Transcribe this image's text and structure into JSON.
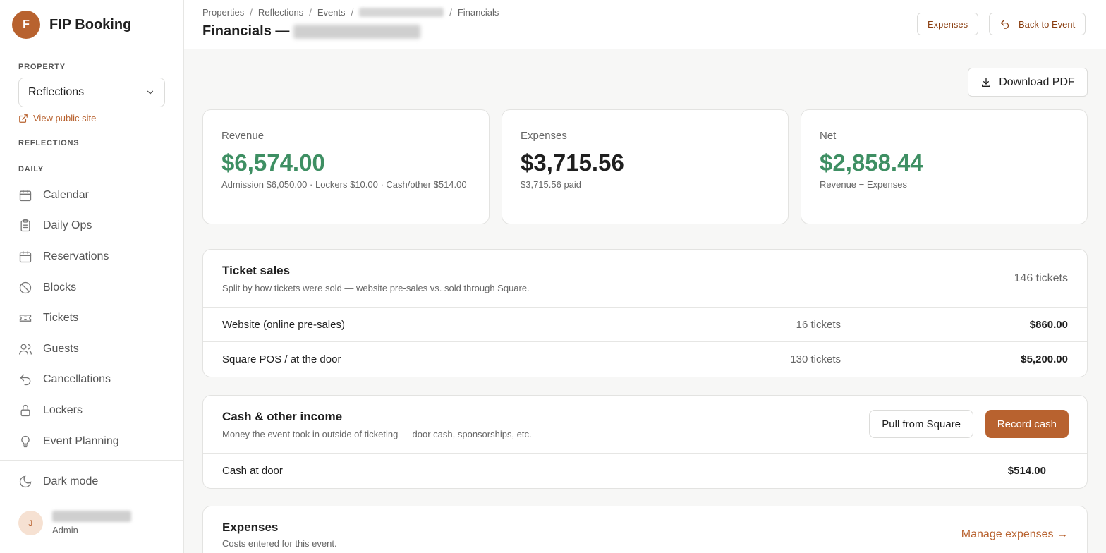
{
  "brand": {
    "logo_letter": "F",
    "name": "FIP Booking",
    "accent": "#b8622f"
  },
  "sidebar": {
    "property_label": "PROPERTY",
    "property_value": "Reflections",
    "public_link": "View public site",
    "section_label": "REFLECTIONS",
    "group_label": "DAILY",
    "items": [
      {
        "label": "Calendar",
        "icon": "calendar-icon"
      },
      {
        "label": "Daily Ops",
        "icon": "clipboard-icon"
      },
      {
        "label": "Reservations",
        "icon": "calendar-icon"
      },
      {
        "label": "Blocks",
        "icon": "ban-icon"
      },
      {
        "label": "Tickets",
        "icon": "ticket-icon"
      },
      {
        "label": "Guests",
        "icon": "users-icon"
      },
      {
        "label": "Cancellations",
        "icon": "undo-icon"
      },
      {
        "label": "Lockers",
        "icon": "lock-icon"
      },
      {
        "label": "Event Planning",
        "icon": "lightbulb-icon"
      }
    ],
    "dark_mode": "Dark mode",
    "user": {
      "initial": "J",
      "role": "Admin"
    }
  },
  "header": {
    "breadcrumbs": [
      "Properties",
      "Reflections",
      "Events",
      "Financials"
    ],
    "title_prefix": "Financials —",
    "expenses_button": "Expenses",
    "back_button": "Back to Event"
  },
  "download_pdf": "Download PDF",
  "stats": {
    "revenue": {
      "label": "Revenue",
      "value": "$6,574.00",
      "sub": "Admission $6,050.00 · Lockers $10.00 · Cash/other $514.00"
    },
    "expenses": {
      "label": "Expenses",
      "value": "$3,715.56",
      "sub": "$3,715.56 paid"
    },
    "net": {
      "label": "Net",
      "value": "$2,858.44",
      "sub": "Revenue − Expenses"
    }
  },
  "ticket_sales": {
    "title": "Ticket sales",
    "desc": "Split by how tickets were sold — website pre-sales vs. sold through Square.",
    "total": "146 tickets",
    "rows": [
      {
        "label": "Website (online pre-sales)",
        "count": "16 tickets",
        "amount": "$860.00"
      },
      {
        "label": "Square POS / at the door",
        "count": "130 tickets",
        "amount": "$5,200.00"
      }
    ]
  },
  "cash_income": {
    "title": "Cash & other income",
    "desc": "Money the event took in outside of ticketing — door cash, sponsorships, etc.",
    "pull_button": "Pull from Square",
    "record_button": "Record cash",
    "rows": [
      {
        "label": "Cash at door",
        "amount": "$514.00"
      }
    ]
  },
  "expenses_panel": {
    "title": "Expenses",
    "desc": "Costs entered for this event.",
    "manage_link": "Manage expenses →"
  }
}
